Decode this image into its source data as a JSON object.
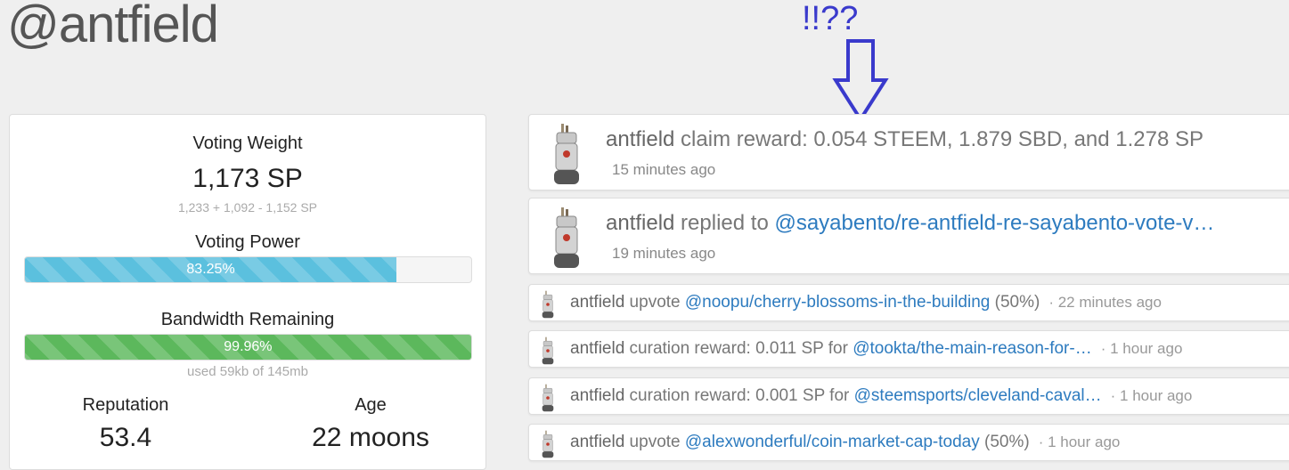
{
  "header": {
    "username": "@antfield"
  },
  "annotation": {
    "text": "!!??"
  },
  "stats": {
    "voting_weight_label": "Voting Weight",
    "voting_weight_value": "1,173 SP",
    "voting_weight_breakdown": "1,233 + 1,092 - 1,152 SP",
    "voting_power_label": "Voting Power",
    "voting_power_text": "83.25%",
    "voting_power_pct": 83.25,
    "bandwidth_label": "Bandwidth Remaining",
    "bandwidth_text": "99.96%",
    "bandwidth_pct": 99.96,
    "bandwidth_usage": "used 59kb of 145mb",
    "reputation_label": "Reputation",
    "reputation_value": "53.4",
    "age_label": "Age",
    "age_value": "22 moons",
    "colors": {
      "voting_power": "#5bc0de",
      "bandwidth": "#5cb85c"
    }
  },
  "feed": [
    {
      "actor": "antfield",
      "text": " claim reward: 0.054 STEEM, 1.879 SBD, and 1.278 SP",
      "time": "15 minutes ago",
      "icon": "robot-avatar-icon"
    },
    {
      "actor": "antfield",
      "text": " replied to ",
      "link": "@sayabento/re-antfield-re-sayabento-vote-v…",
      "time": "19 minutes ago",
      "icon": "robot-avatar-icon"
    },
    {
      "actor": "antfield",
      "text": " upvote ",
      "link": "@noopu/cherry-blossoms-in-the-building",
      "suffix": " (50%)",
      "time": "22 minutes ago",
      "icon": "robot-avatar-icon"
    },
    {
      "actor": "antfield",
      "text": " curation reward: 0.011 SP for ",
      "link": "@tookta/the-main-reason-for-…",
      "suffix": "",
      "time": "1 hour ago",
      "icon": "robot-avatar-icon"
    },
    {
      "actor": "antfield",
      "text": " curation reward: 0.001 SP for ",
      "link": "@steemsports/cleveland-caval…",
      "suffix": "",
      "time": "1 hour ago",
      "icon": "robot-avatar-icon"
    },
    {
      "actor": "antfield",
      "text": " upvote ",
      "link": "@alexwonderful/coin-market-cap-today",
      "suffix": " (50%)",
      "time": "1 hour ago",
      "icon": "robot-avatar-icon"
    }
  ]
}
